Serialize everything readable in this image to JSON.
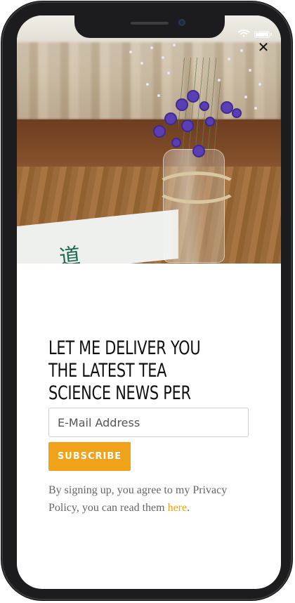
{
  "popup": {
    "close_symbol": "✕",
    "headline": "Let me deliver you the latest tea science news per mail",
    "email_placeholder": "E-Mail Address",
    "subscribe_label": "SUBSCRIBE",
    "disclaimer_text": "By signing up, you agree to my Privacy Policy, you can read them ",
    "disclaimer_link": "here",
    "disclaimer_end": "."
  },
  "colors": {
    "accent": "#f0a21b",
    "frame": "#1c1c1e",
    "text": "#111111",
    "muted_text": "#666666"
  },
  "icons": [
    "wifi-icon",
    "battery-icon",
    "close-icon"
  ]
}
